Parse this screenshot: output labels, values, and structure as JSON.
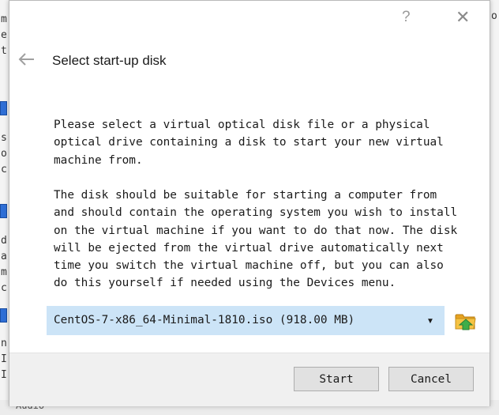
{
  "dialog": {
    "help_label": "?",
    "close_label": "✕",
    "heading": "Select start-up disk",
    "paragraph1": "Please select a virtual optical disk file or a physical\noptical drive containing a disk to start your new virtual\nmachine from.",
    "paragraph2": "The disk should be suitable for starting a computer from\nand should contain the operating system you wish to install\non the virtual machine if you want to do that now. The disk\nwill be ejected from the virtual drive automatically next\ntime you switch the virtual machine off, but you can also\ndo this yourself if needed using the Devices menu.",
    "disk_selector": {
      "selected": "CentOS-7-x86_64-Minimal-1810.iso (918.00 MB)",
      "arrow": "▼"
    },
    "buttons": {
      "start": "Start",
      "cancel": "Cancel"
    }
  },
  "background": {
    "left_chars": [
      "m",
      "e",
      "t",
      "s",
      "o",
      "c",
      "d",
      "a",
      "m",
      "c",
      "n",
      "I",
      "I"
    ],
    "right_chars": [
      "o"
    ],
    "bottom_text": "Audio"
  },
  "colors": {
    "combo_selected_bg": "#cce4f7",
    "footer_bg": "#f0f0f0",
    "button_bg": "#e1e1e1",
    "folder_yellow": "#f0b429",
    "folder_green": "#3fae49"
  }
}
